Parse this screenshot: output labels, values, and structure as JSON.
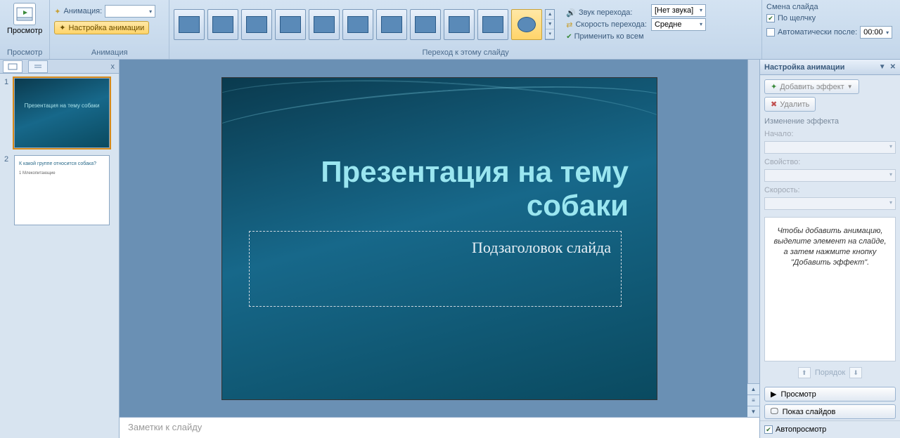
{
  "ribbon": {
    "preview_group": {
      "label": "Просмотр",
      "button": "Просмотр"
    },
    "animation_group": {
      "label": "Анимация",
      "anim_label": "Анимация:",
      "anim_value": "",
      "custom_btn": "Настройка анимации"
    },
    "transition_group": {
      "label": "Переход к этому слайду",
      "sound_label": "Звук перехода:",
      "sound_value": "[Нет звука]",
      "speed_label": "Скорость перехода:",
      "speed_value": "Средне",
      "apply_all": "Применить ко всем"
    },
    "advance_group": {
      "label": "Смена слайда",
      "on_click": "По щелчку",
      "auto_after": "Автоматически после:",
      "auto_time": "00:00"
    }
  },
  "thumbnails": {
    "close": "x",
    "slides": [
      {
        "num": "1",
        "title": "Презентация на тему собаки"
      },
      {
        "num": "2",
        "title": "К какой группе относится собака?"
      }
    ]
  },
  "slide": {
    "title": "Презентация на тему собаки",
    "subtitle": "Подзаголовок слайда"
  },
  "notes": {
    "placeholder": "Заметки к слайду"
  },
  "taskpane": {
    "title": "Настройка анимации",
    "add_effect": "Добавить эффект",
    "remove": "Удалить",
    "change_label": "Изменение эффекта",
    "start_label": "Начало:",
    "property_label": "Свойство:",
    "speed_label": "Скорость:",
    "hint": "Чтобы добавить анимацию, выделите элемент на слайде, а затем нажмите кнопку \"Добавить эффект\".",
    "order_label": "Порядок",
    "preview_btn": "Просмотр",
    "slideshow_btn": "Показ слайдов",
    "autopreview": "Автопросмотр"
  }
}
